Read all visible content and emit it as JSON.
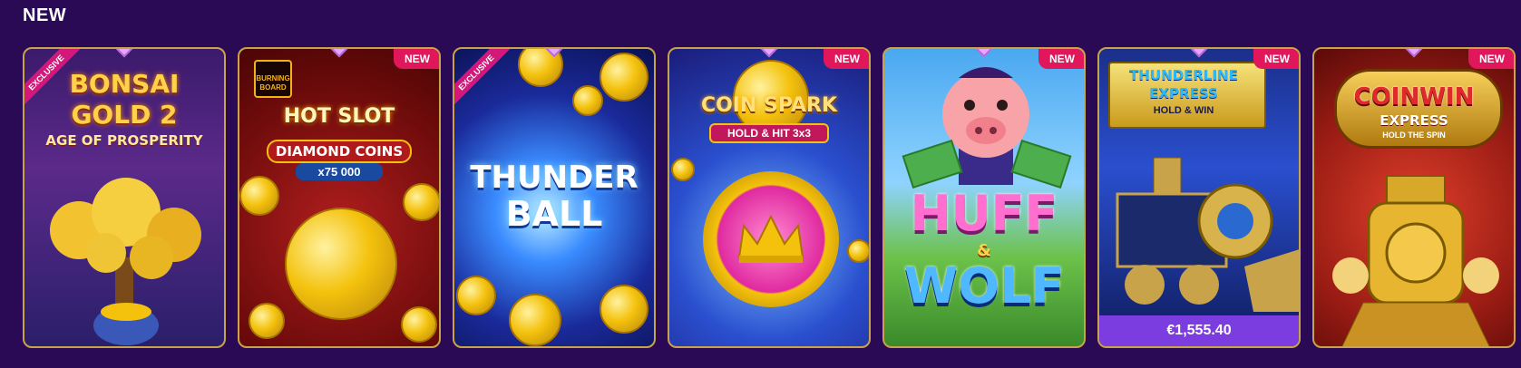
{
  "section": {
    "title": "NEW"
  },
  "games": [
    {
      "name": "Bonsai Gold 2",
      "logo_line1": "BONSAI",
      "logo_line2": "GOLD 2",
      "logo_line3": "AGE OF PROSPERITY",
      "ribbon": "EXCLUSIVE"
    },
    {
      "name": "Hot Slot Diamond Coins",
      "brand": "BURNING BOARD",
      "logo_line1": "HOT SLOT",
      "logo_line2": "DIAMOND COINS",
      "logo_line3": "x75 000",
      "badge": "NEW"
    },
    {
      "name": "Thunder Ball",
      "logo_line1": "THUNDER",
      "logo_line2": "BALL",
      "ribbon": "EXCLUSIVE"
    },
    {
      "name": "Coin Spark",
      "logo_line1": "COIN SPARK",
      "logo_line2": "HOLD & HIT 3x3",
      "badge": "NEW"
    },
    {
      "name": "Huff & Wolf",
      "logo_line1": "HUFF",
      "logo_line2": "&",
      "logo_line3": "WOLF",
      "badge": "NEW"
    },
    {
      "name": "Thunderline Express",
      "logo_line1": "THUNDERLINE",
      "logo_line2": "EXPRESS",
      "logo_line3": "HOLD & WIN",
      "badge": "NEW",
      "jackpot": "€1,555.40"
    },
    {
      "name": "Coin Win Express",
      "logo_line1": "COINWIN",
      "logo_line2": "EXPRESS",
      "logo_line3": "HOLD THE SPIN",
      "badge": "NEW"
    }
  ],
  "colors": {
    "background": "#2a0a55",
    "badge": "#e0175a",
    "jackpot_bar": "#7c3de0",
    "frame": "#c9a34a"
  }
}
